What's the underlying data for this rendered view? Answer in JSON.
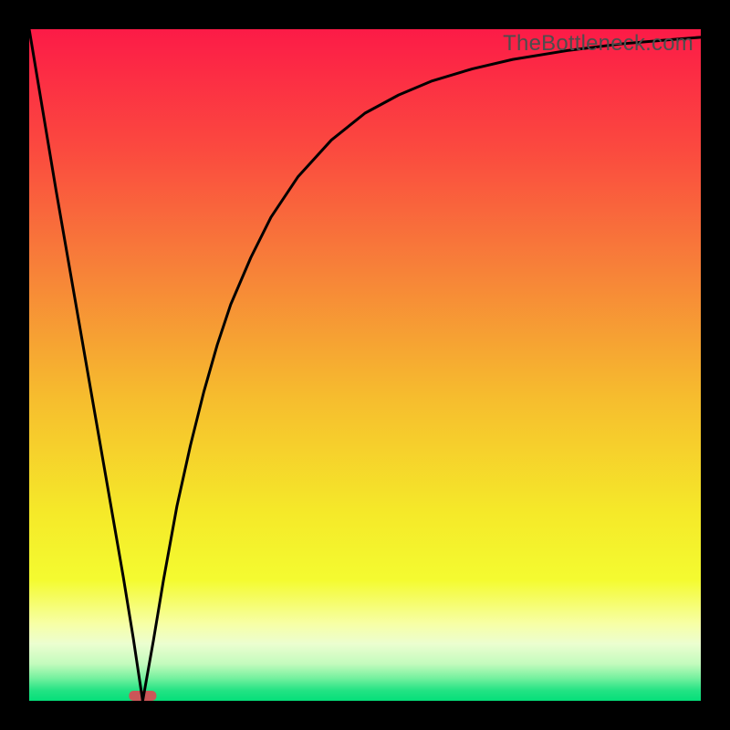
{
  "watermark": "TheBottleneck.com",
  "chart_data": {
    "type": "line",
    "title": "",
    "xlabel": "",
    "ylabel": "",
    "xlim": [
      0,
      100
    ],
    "ylim": [
      0,
      100
    ],
    "grid": false,
    "legend": false,
    "marker": {
      "x": 16.9,
      "y": 0.5,
      "width": 4.1,
      "color": "#cb5658"
    },
    "series": [
      {
        "name": "curve",
        "color": "#000000",
        "x": [
          0,
          2,
          4,
          6,
          8,
          10,
          12,
          14,
          15.5,
          16.9,
          18.5,
          20,
          22,
          24,
          26,
          28,
          30,
          33,
          36,
          40,
          45,
          50,
          55,
          60,
          66,
          72,
          80,
          88,
          95,
          100
        ],
        "y": [
          100,
          88,
          76,
          64.5,
          53,
          41.5,
          30,
          18.5,
          9.3,
          0,
          9,
          18,
          29,
          38,
          46,
          53,
          59,
          66,
          72,
          78,
          83.5,
          87.5,
          90.2,
          92.3,
          94.1,
          95.5,
          96.8,
          97.8,
          98.4,
          98.8
        ]
      }
    ],
    "background_gradient": {
      "stops": [
        {
          "pos": 0.0,
          "color": "#fc1b47"
        },
        {
          "pos": 0.18,
          "color": "#fb4a3f"
        },
        {
          "pos": 0.35,
          "color": "#f77f39"
        },
        {
          "pos": 0.55,
          "color": "#f6bd2e"
        },
        {
          "pos": 0.72,
          "color": "#f5e929"
        },
        {
          "pos": 0.82,
          "color": "#f4fb30"
        },
        {
          "pos": 0.885,
          "color": "#f7ffa5"
        },
        {
          "pos": 0.915,
          "color": "#ecfed0"
        },
        {
          "pos": 0.945,
          "color": "#c3fbbd"
        },
        {
          "pos": 0.965,
          "color": "#79f1a0"
        },
        {
          "pos": 0.985,
          "color": "#22e383"
        },
        {
          "pos": 1.0,
          "color": "#05df7a"
        }
      ]
    }
  }
}
